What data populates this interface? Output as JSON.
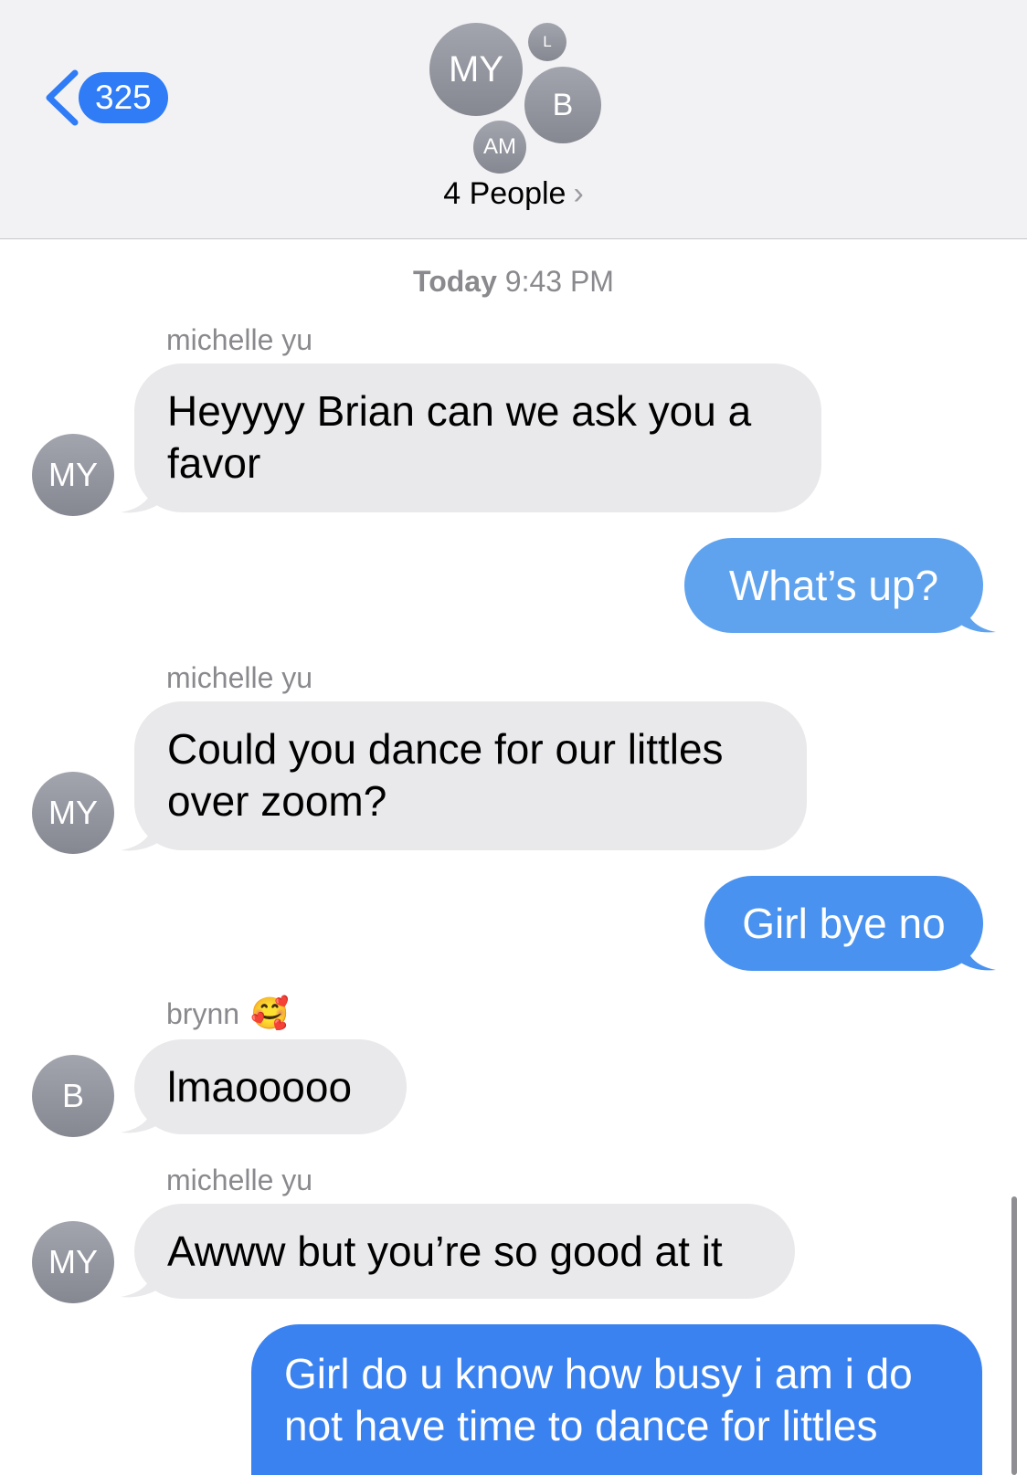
{
  "header": {
    "back_count": "325",
    "group_avatars": [
      "MY",
      "L",
      "B",
      "AM"
    ],
    "people_label": "4 People",
    "people_chevron": "›"
  },
  "timestamp": {
    "day": "Today",
    "time": "9:43 PM"
  },
  "messages": [
    {
      "sender": "michelle yu",
      "avatar": "MY",
      "line1": "Heyyyy Brian can we ask you a",
      "line2": "favor"
    },
    {
      "text": "What’s up?"
    },
    {
      "sender": "michelle yu",
      "avatar": "MY",
      "line1": "Could you dance for our littles",
      "line2": "over zoom?"
    },
    {
      "text": "Girl bye no"
    },
    {
      "sender": "brynn",
      "sender_emoji": "🥰",
      "avatar": "B",
      "line1": "lmaooooo"
    },
    {
      "sender": "michelle yu",
      "avatar": "MY",
      "line1": "Awww but you’re so good at it"
    },
    {
      "line1": "Girl do u know how busy i am i do",
      "line2": "not have time to dance for littles"
    }
  ],
  "colors": {
    "outgoing_light": "#5fa3ef",
    "outgoing": "#4a92ef",
    "outgoing_dark": "#3b82f1",
    "incoming": "#e9e9eb",
    "accent": "#2f7cf6"
  },
  "icons": [
    "back-chevron-icon",
    "chevron-right-icon",
    "smiling-face-with-hearts-emoji"
  ]
}
